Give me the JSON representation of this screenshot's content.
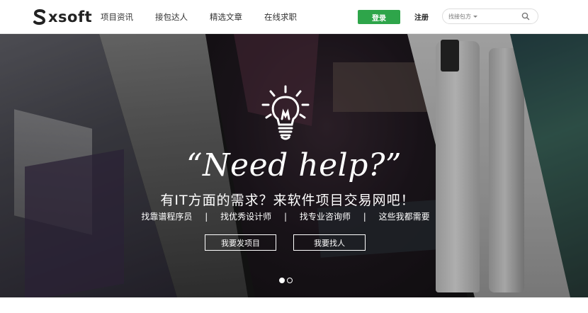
{
  "brand": {
    "logo_text": "xsoft"
  },
  "nav": {
    "items": [
      {
        "label": "项目资讯"
      },
      {
        "label": "接包达人"
      },
      {
        "label": "精选文章"
      },
      {
        "label": "在线求职"
      }
    ]
  },
  "auth": {
    "login_label": "登录",
    "register_label": "注册"
  },
  "search": {
    "scope_label": "找接包方",
    "placeholder": ""
  },
  "banner": {
    "headline": "“Need help?”",
    "subtitle": "有IT方面的需求？来软件项目交易网吧！",
    "tags": [
      "找靠谱程序员",
      "找优秀设计师",
      "找专业咨询师",
      "这些我都需要"
    ],
    "separator": "|",
    "cta_post": "我要发项目",
    "cta_find": "我要找人",
    "slides": {
      "count": 2,
      "active_index": 0
    }
  },
  "colors": {
    "accent": "#2ea54a",
    "header_bg": "#ffffff",
    "banner_text": "#ffffff"
  }
}
